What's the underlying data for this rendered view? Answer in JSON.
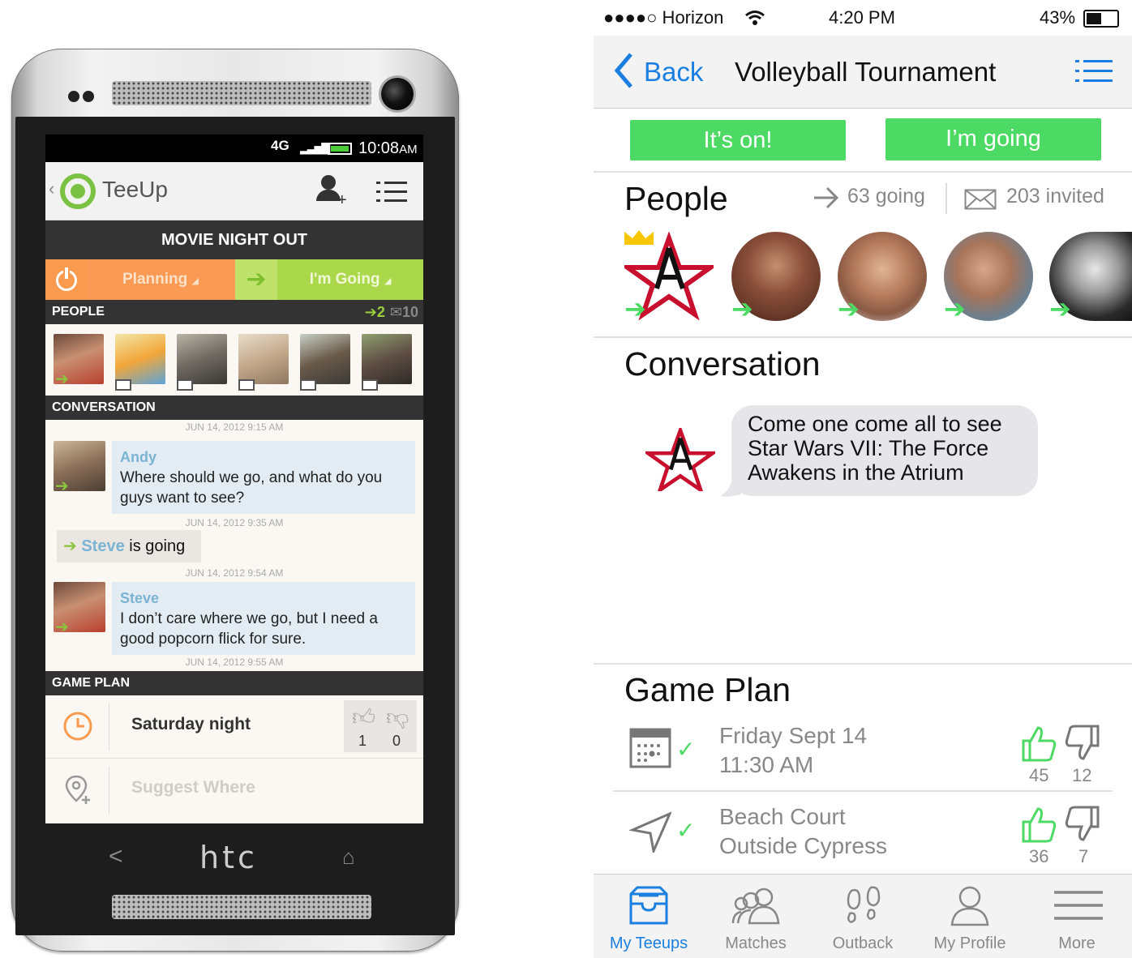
{
  "android": {
    "status": {
      "network": "4G",
      "time": "10:08",
      "ampm": "AM"
    },
    "app_bar": {
      "brand": "TeeUp"
    },
    "event_title": "MOVIE NIGHT OUT",
    "status_row": {
      "planning_label": "Planning",
      "going_label": "I'm Going"
    },
    "people": {
      "header": "PEOPLE",
      "going_count": "2",
      "invited_count": "10"
    },
    "conversation": {
      "header": "CONVERSATION",
      "stamps": [
        "JUN 14, 2012 9:15 AM",
        "JUN 14, 2012 9:35 AM",
        "JUN 14, 2012 9:54 AM",
        "JUN 14, 2012 9:55 AM"
      ],
      "messages": [
        {
          "author": "Andy",
          "text": "Where should we go, and what do you guys want to see?"
        },
        {
          "author": "Steve",
          "text": "I don’t care where we go, but I need a good popcorn flick for sure."
        }
      ],
      "going_note": {
        "name": "Steve",
        "suffix": "is going"
      }
    },
    "game_plan": {
      "header": "GAME PLAN",
      "when": "Saturday night",
      "votes_up": "1",
      "votes_down": "0",
      "suggest_where": "Suggest Where"
    },
    "brand_label": "htc"
  },
  "ios": {
    "status": {
      "carrier": "●●●●○ Horizon",
      "time": "4:20 PM",
      "battery": "43%"
    },
    "nav": {
      "back": "Back",
      "title": "Volleyball Tournament"
    },
    "buttons": {
      "its_on": "It’s on!",
      "im_going": "I’m going"
    },
    "people": {
      "title": "People",
      "going": "63 going",
      "invited": "203 invited"
    },
    "conversation": {
      "title": "Conversation",
      "message": "Come one come all to see Star Wars VII: The Force Awakens in the Atrium"
    },
    "game_plan": {
      "title": "Game Plan",
      "items": [
        {
          "line1": "Friday Sept 14",
          "line2": "11:30 AM",
          "up": "45",
          "down": "12"
        },
        {
          "line1": "Beach Court",
          "line2": "Outside Cypress",
          "up": "36",
          "down": "7"
        }
      ]
    },
    "tabs": [
      {
        "label": "My Teeups",
        "active": true
      },
      {
        "label": "Matches"
      },
      {
        "label": "Outback"
      },
      {
        "label": "My Profile"
      },
      {
        "label": "More"
      }
    ],
    "colors": {
      "accent_blue": "#1a7fe0",
      "go_green": "#4cd964"
    }
  }
}
